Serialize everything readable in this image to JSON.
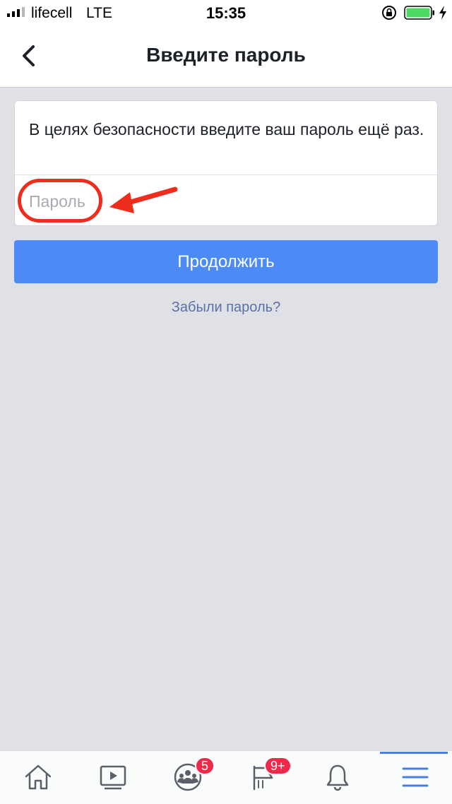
{
  "status_bar": {
    "carrier": "lifecell",
    "network": "LTE",
    "time": "15:35"
  },
  "nav": {
    "title": "Введите пароль"
  },
  "card": {
    "message": "В целях безопасности введите ваш пароль ещё раз.",
    "password_placeholder": "Пароль",
    "password_value": ""
  },
  "actions": {
    "continue_label": "Продолжить",
    "forgot_label": "Забыли пароль?"
  },
  "tabbar": {
    "tabs": [
      {
        "icon": "home-icon"
      },
      {
        "icon": "video-icon"
      },
      {
        "icon": "groups-icon",
        "badge": "5"
      },
      {
        "icon": "pages-flag-icon",
        "badge": "9+"
      },
      {
        "icon": "bell-icon"
      },
      {
        "icon": "menu-icon",
        "active": true
      }
    ]
  },
  "colors": {
    "primary_button": "#4c8bf5",
    "link": "#5b70a6",
    "background": "#dfe1e6",
    "annotation": "#ef2d1e",
    "badge": "#f02849",
    "battery": "#4cd964"
  }
}
